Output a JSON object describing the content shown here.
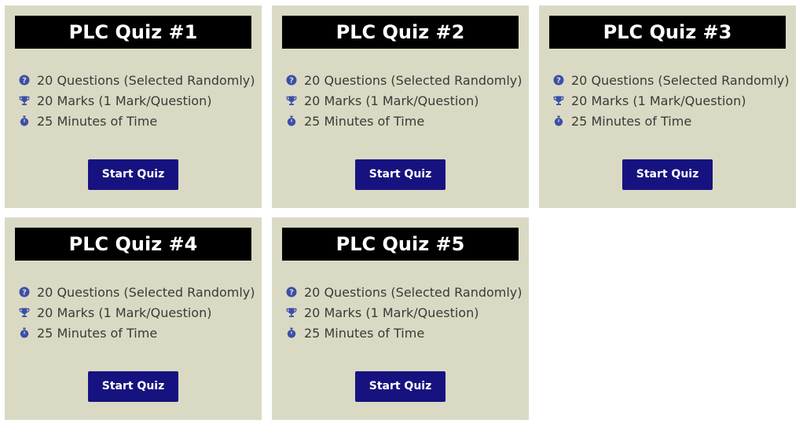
{
  "colors": {
    "card_background": "#dadac4",
    "title_background": "#000000",
    "title_text": "#ffffff",
    "icon_color": "#3b4fa8",
    "button_background": "#161380",
    "button_text": "#ffffff"
  },
  "quizzes": [
    {
      "title": "PLC Quiz #1",
      "features": [
        {
          "icon": "question-circle-icon",
          "text": "20 Questions (Selected Randomly)"
        },
        {
          "icon": "trophy-icon",
          "text": "20 Marks (1 Mark/Question)"
        },
        {
          "icon": "stopwatch-icon",
          "text": "25 Minutes of Time"
        }
      ],
      "button_label": "Start Quiz"
    },
    {
      "title": "PLC Quiz #2",
      "features": [
        {
          "icon": "question-circle-icon",
          "text": "20 Questions (Selected Randomly)"
        },
        {
          "icon": "trophy-icon",
          "text": "20 Marks (1 Mark/Question)"
        },
        {
          "icon": "stopwatch-icon",
          "text": "25 Minutes of Time"
        }
      ],
      "button_label": "Start Quiz"
    },
    {
      "title": "PLC Quiz #3",
      "features": [
        {
          "icon": "question-circle-icon",
          "text": "20 Questions (Selected Randomly)"
        },
        {
          "icon": "trophy-icon",
          "text": "20 Marks (1 Mark/Question)"
        },
        {
          "icon": "stopwatch-icon",
          "text": "25 Minutes of Time"
        }
      ],
      "button_label": "Start Quiz"
    },
    {
      "title": "PLC Quiz #4",
      "features": [
        {
          "icon": "question-circle-icon",
          "text": "20 Questions (Selected Randomly)"
        },
        {
          "icon": "trophy-icon",
          "text": "20 Marks (1 Mark/Question)"
        },
        {
          "icon": "stopwatch-icon",
          "text": "25 Minutes of Time"
        }
      ],
      "button_label": "Start Quiz"
    },
    {
      "title": "PLC Quiz #5",
      "features": [
        {
          "icon": "question-circle-icon",
          "text": "20 Questions (Selected Randomly)"
        },
        {
          "icon": "trophy-icon",
          "text": "20 Marks (1 Mark/Question)"
        },
        {
          "icon": "stopwatch-icon",
          "text": "25 Minutes of Time"
        }
      ],
      "button_label": "Start Quiz"
    }
  ]
}
